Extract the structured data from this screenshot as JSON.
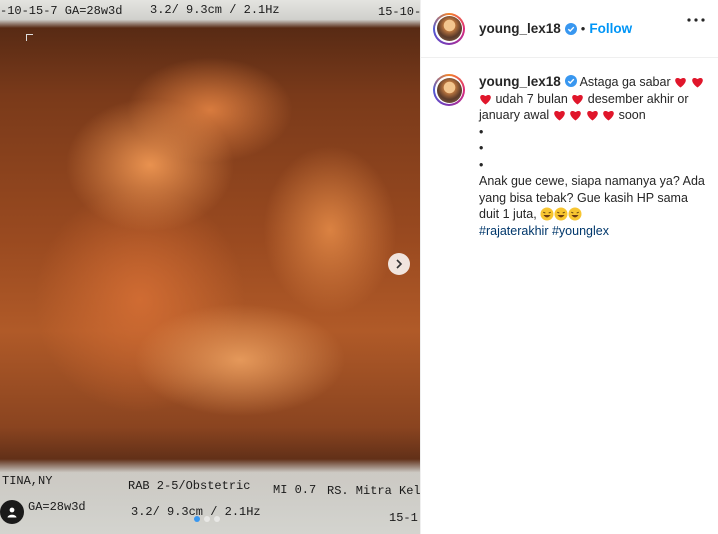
{
  "media": {
    "overlay": {
      "top_left": "-10-15-7 GA=28w3d",
      "top_mid": "3.2/ 9.3cm / 2.1Hz",
      "top_right": "15-10-",
      "bottom_l1": "TINA,NY",
      "bottom_l2": "RAB 2-5/Obstetric",
      "bottom_l3": "MI 0.7",
      "bottom_l4": "RS. Mitra Kelu",
      "bottom_r1": "GA=28w3d",
      "bottom_r2": "3.2/ 9.3cm / 2.1Hz",
      "bottom_r3": "15-1"
    },
    "carousel": {
      "count": 3,
      "active": 0
    }
  },
  "post": {
    "username": "young_lex18",
    "follow_label": "Follow",
    "separator": "•"
  },
  "caption": {
    "username": "young_lex18",
    "t1": "Astaga ga sabar",
    "t2": "udah 7 bulan",
    "t3": "desember akhir or january awal",
    "t4": "soon",
    "bullet": "•",
    "t5": "Anak gue cewe, siapa namanya ya? Ada yang bisa tebak? Gue kasih HP sama duit 1 juta,",
    "hashtag1": "#rajaterakhir",
    "hashtag2": "#younglex"
  },
  "icons": {
    "verified": "verified-badge-icon",
    "more": "more-options-icon",
    "next": "chevron-right-icon",
    "user": "user-tag-icon",
    "heart": "red-heart-emoji-icon",
    "laugh": "laughing-emoji-icon"
  },
  "colors": {
    "accent": "#0095f6",
    "verified": "#3897f0",
    "heart": "#e0162b",
    "hashtag": "#00376b"
  }
}
